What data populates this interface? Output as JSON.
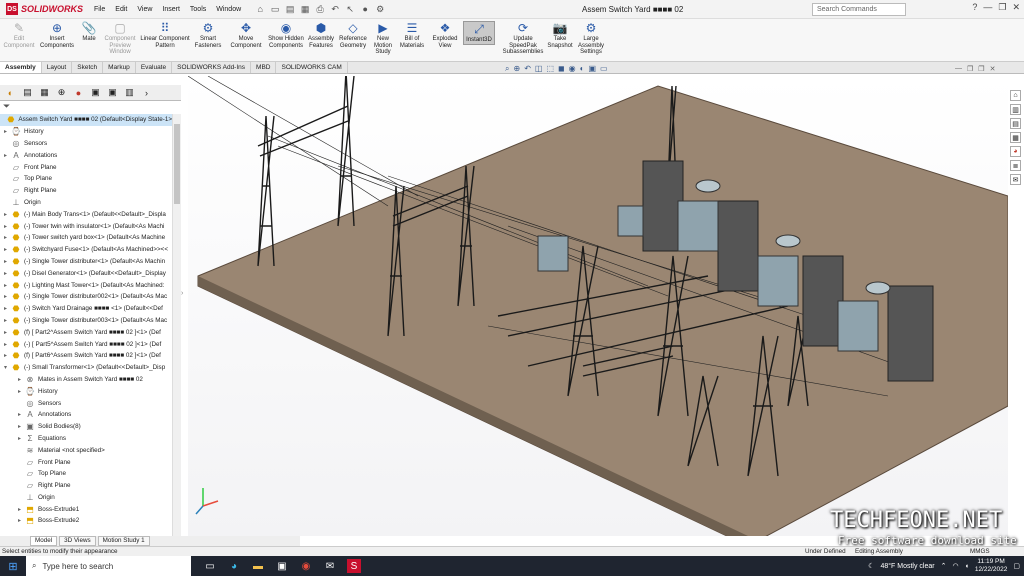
{
  "app": {
    "logo_text": "SOLIDWORKS",
    "window_title": "Assem Switch Yard ■■■■ 02",
    "menus": [
      "File",
      "Edit",
      "View",
      "Insert",
      "Tools",
      "Window"
    ],
    "search_placeholder": "Search Commands"
  },
  "ribbon": {
    "buttons": [
      {
        "label": "Edit Component",
        "icon": "edit-component-icon",
        "glyph": "✎",
        "enabled": false
      },
      {
        "label": "Insert Components",
        "icon": "insert-components-icon",
        "glyph": "⊕",
        "enabled": true
      },
      {
        "label": "Mate",
        "icon": "mate-icon",
        "glyph": "📎",
        "enabled": true
      },
      {
        "label": "Component Preview Window",
        "icon": "preview-window-icon",
        "glyph": "▢",
        "enabled": false
      },
      {
        "label": "Linear Component Pattern",
        "icon": "linear-pattern-icon",
        "glyph": "⠿",
        "enabled": true
      },
      {
        "label": "Smart Fasteners",
        "icon": "smart-fasteners-icon",
        "glyph": "⚙",
        "enabled": true
      },
      {
        "label": "Move Component",
        "icon": "move-component-icon",
        "glyph": "✥",
        "enabled": true
      },
      {
        "label": "Show Hidden Components",
        "icon": "show-hidden-icon",
        "glyph": "◉",
        "enabled": true
      },
      {
        "label": "Assembly Features",
        "icon": "assembly-features-icon",
        "glyph": "⬢",
        "enabled": true
      },
      {
        "label": "Reference Geometry",
        "icon": "reference-geometry-icon",
        "glyph": "◇",
        "enabled": true
      },
      {
        "label": "New Motion Study",
        "icon": "motion-study-icon",
        "glyph": "▶",
        "enabled": true
      },
      {
        "label": "Bill of Materials",
        "icon": "bom-icon",
        "glyph": "☰",
        "enabled": true
      },
      {
        "label": "Exploded View",
        "icon": "exploded-view-icon",
        "glyph": "❖",
        "enabled": true
      },
      {
        "label": "Instant3D",
        "icon": "instant3d-icon",
        "glyph": "⤢",
        "enabled": true,
        "active": true
      },
      {
        "label": "Update SpeedPak Subassemblies",
        "icon": "speedpak-icon",
        "glyph": "⟳",
        "enabled": true
      },
      {
        "label": "Take Snapshot",
        "icon": "snapshot-icon",
        "glyph": "📷",
        "enabled": true
      },
      {
        "label": "Large Assembly Settings",
        "icon": "large-assembly-icon",
        "glyph": "⚙",
        "enabled": true
      }
    ]
  },
  "command_tabs": [
    "Assembly",
    "Layout",
    "Sketch",
    "Markup",
    "Evaluate",
    "SOLIDWORKS Add-Ins",
    "MBD",
    "SOLIDWORKS CAM"
  ],
  "active_command_tab": "Assembly",
  "feature_tree": {
    "root": "Assem Switch Yard ■■■■ 02  (Default<Display State-1>",
    "items": [
      {
        "label": "History",
        "icon": "history-icon",
        "glyph": "⌚",
        "kind": "plane",
        "level": 1,
        "expand": "▸"
      },
      {
        "label": "Sensors",
        "icon": "sensors-icon",
        "glyph": "◎",
        "kind": "plane",
        "level": 1,
        "expand": ""
      },
      {
        "label": "Annotations",
        "icon": "annotations-icon",
        "glyph": "A",
        "kind": "plane",
        "level": 1,
        "expand": "▸"
      },
      {
        "label": "Front Plane",
        "icon": "plane-icon",
        "glyph": "▱",
        "kind": "plane",
        "level": 1,
        "expand": ""
      },
      {
        "label": "Top Plane",
        "icon": "plane-icon",
        "glyph": "▱",
        "kind": "plane",
        "level": 1,
        "expand": ""
      },
      {
        "label": "Right Plane",
        "icon": "plane-icon",
        "glyph": "▱",
        "kind": "plane",
        "level": 1,
        "expand": ""
      },
      {
        "label": "Origin",
        "icon": "origin-icon",
        "glyph": "⊥",
        "kind": "plane",
        "level": 1,
        "expand": ""
      },
      {
        "label": "(-) Main Body Trans<1> (Default<<Default>_Displa",
        "icon": "part-icon",
        "glyph": "⬣",
        "kind": "part",
        "level": 1,
        "expand": "▸"
      },
      {
        "label": "(-) Tower twin with insulator<1> (Default<As Machi",
        "icon": "part-icon",
        "glyph": "⬣",
        "kind": "part",
        "level": 1,
        "expand": "▸"
      },
      {
        "label": "(-) Tower switch yard box<1> (Default<As Machine",
        "icon": "part-icon",
        "glyph": "⬣",
        "kind": "part",
        "level": 1,
        "expand": "▸"
      },
      {
        "label": "(-) Switchyard Fuse<1> (Default<As Machined>><<",
        "icon": "part-icon",
        "glyph": "⬣",
        "kind": "part",
        "level": 1,
        "expand": "▸"
      },
      {
        "label": "(-) Single Tower distributer<1> (Default<As Machin",
        "icon": "part-icon",
        "glyph": "⬣",
        "kind": "part",
        "level": 1,
        "expand": "▸"
      },
      {
        "label": "(-) Disel Generator<1> (Default<<Default>_Display",
        "icon": "part-icon",
        "glyph": "⬣",
        "kind": "part",
        "level": 1,
        "expand": "▸"
      },
      {
        "label": "(-) Lighting Mast Tower<1> (Default<As Machined:",
        "icon": "part-icon",
        "glyph": "⬣",
        "kind": "part",
        "level": 1,
        "expand": "▸"
      },
      {
        "label": "(-) Single Tower distributer002<1> (Default<As Mac",
        "icon": "part-icon",
        "glyph": "⬣",
        "kind": "part",
        "level": 1,
        "expand": "▸"
      },
      {
        "label": "(-) Switch Yard Drainage ■■■■ <1> (Default<<Def",
        "icon": "part-icon",
        "glyph": "⬣",
        "kind": "part",
        "level": 1,
        "expand": "▸"
      },
      {
        "label": "(-) Single Tower distributer003<1> (Default<As Mac",
        "icon": "part-icon",
        "glyph": "⬣",
        "kind": "part",
        "level": 1,
        "expand": "▸"
      },
      {
        "label": "(f) [ Part2^Assem Switch Yard ■■■■ 02 ]<1> (Def",
        "icon": "part-icon",
        "glyph": "⬣",
        "kind": "part",
        "level": 1,
        "expand": "▸"
      },
      {
        "label": "(-) [ Part5^Assem Switch Yard ■■■■ 02 ]<1> (Def",
        "icon": "part-icon",
        "glyph": "⬣",
        "kind": "part",
        "level": 1,
        "expand": "▸"
      },
      {
        "label": "(f) [ Part6^Assem Switch Yard ■■■■ 02 ]<1> (Def",
        "icon": "part-icon",
        "glyph": "⬣",
        "kind": "part",
        "level": 1,
        "expand": "▸"
      },
      {
        "label": "(-) Small Transformer<1> (Default<<Default>_Disp",
        "icon": "part-icon",
        "glyph": "⬣",
        "kind": "part",
        "level": 1,
        "expand": "▾"
      },
      {
        "label": "Mates in Assem Switch Yard ■■■■ 02",
        "icon": "mates-icon",
        "glyph": "⊗",
        "kind": "plane",
        "level": 2,
        "expand": "▸"
      },
      {
        "label": "History",
        "icon": "history-icon",
        "glyph": "⌚",
        "kind": "plane",
        "level": 2,
        "expand": "▸"
      },
      {
        "label": "Sensors",
        "icon": "sensors-icon",
        "glyph": "◎",
        "kind": "plane",
        "level": 2,
        "expand": ""
      },
      {
        "label": "Annotations",
        "icon": "annotations-icon",
        "glyph": "A",
        "kind": "plane",
        "level": 2,
        "expand": "▸"
      },
      {
        "label": "Solid Bodies(8)",
        "icon": "solid-bodies-icon",
        "glyph": "▣",
        "kind": "plane",
        "level": 2,
        "expand": "▸"
      },
      {
        "label": "Equations",
        "icon": "equations-icon",
        "glyph": "Σ",
        "kind": "plane",
        "level": 2,
        "expand": "▸"
      },
      {
        "label": "Material <not specified>",
        "icon": "material-icon",
        "glyph": "≋",
        "kind": "plane",
        "level": 2,
        "expand": ""
      },
      {
        "label": "Front Plane",
        "icon": "plane-icon",
        "glyph": "▱",
        "kind": "plane",
        "level": 2,
        "expand": ""
      },
      {
        "label": "Top Plane",
        "icon": "plane-icon",
        "glyph": "▱",
        "kind": "plane",
        "level": 2,
        "expand": ""
      },
      {
        "label": "Right Plane",
        "icon": "plane-icon",
        "glyph": "▱",
        "kind": "plane",
        "level": 2,
        "expand": ""
      },
      {
        "label": "Origin",
        "icon": "origin-icon",
        "glyph": "⊥",
        "kind": "plane",
        "level": 2,
        "expand": ""
      },
      {
        "label": "Boss-Extrude1",
        "icon": "extrude-icon",
        "glyph": "⬒",
        "kind": "part",
        "level": 2,
        "expand": "▸"
      },
      {
        "label": "Boss-Extrude2",
        "icon": "extrude-icon",
        "glyph": "⬒",
        "kind": "part",
        "level": 2,
        "expand": "▸"
      }
    ]
  },
  "bottom_tabs": [
    "Model",
    "3D Views",
    "Motion Study 1"
  ],
  "status": {
    "message": "Select entities to modify their appearance",
    "under_defined": "Under Defined",
    "editing": "Editing Assembly",
    "units": "MMGS"
  },
  "watermark": {
    "title": "TECHFEONE.NET",
    "subtitle": "Free software download site"
  },
  "taskbar": {
    "search_placeholder": "Type here to search",
    "weather": "48°F  Mostly clear",
    "time": "11:19 PM",
    "date": "12/22/2022"
  }
}
